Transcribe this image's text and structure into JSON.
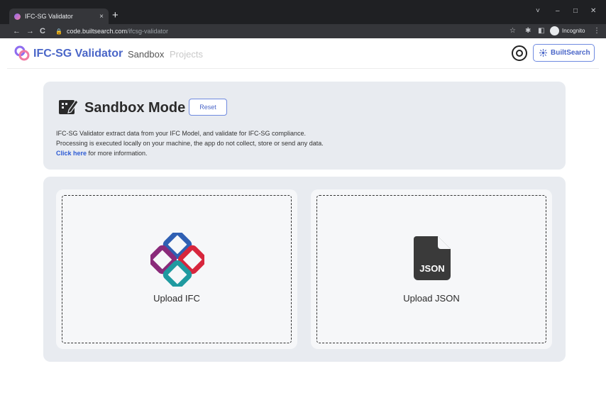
{
  "browser": {
    "tab_title": "IFC-SG Validator",
    "tab_close": "×",
    "new_tab": "+",
    "url_host": "code.builtsearch.com",
    "url_path": "/ifcsg-validator",
    "incognito_label": "Incognito",
    "back": "←",
    "forward": "→",
    "reload": "C",
    "lock": "🔒",
    "star": "☆",
    "ext": "✱",
    "sidepanel": "◧",
    "menu": "⋮",
    "chevron": "˅",
    "minimize": "–",
    "maximize": "□",
    "close": "✕"
  },
  "header": {
    "brand": "IFC-SG Validator",
    "nav": [
      {
        "label": "Sandbox"
      },
      {
        "label": "Projects"
      }
    ],
    "builtsearch_label": "BuiltSearch"
  },
  "sandbox": {
    "title": "Sandbox Mode",
    "reset_label": "Reset",
    "desc_line1": "IFC-SG Validator extract data from your IFC Model, and validate for IFC-SG compliance.",
    "desc_line2": "Processing is executed locally on your machine, the app do not collect, store or send any data.",
    "link_text": "Click here",
    "link_suffix": " for more information."
  },
  "uploads": {
    "ifc_label": "Upload IFC",
    "json_label": "Upload JSON",
    "json_icon_text": "JSON"
  },
  "colors": {
    "accent": "#4a66c8",
    "card_bg": "#e8ebf0",
    "link": "#2d5bd4"
  }
}
